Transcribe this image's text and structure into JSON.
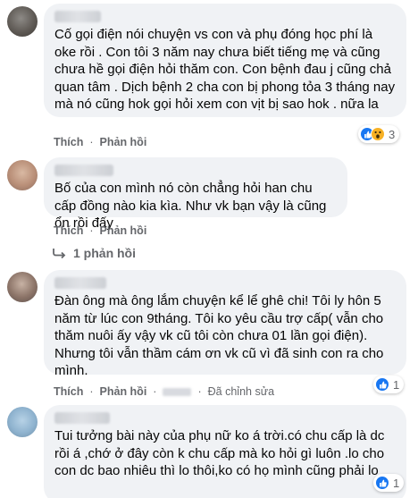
{
  "comments": [
    {
      "text": "Cố gọi điện nói chuyện vs con và phụ đóng học phí là oke rồi . Con tôi 3 năm nay chưa biết tiếng mẹ và cũng chưa hề gọi điện hỏi thăm con. Con bệnh đau j cũng chả quan tâm . Dịch bệnh 2 cha con bị phong tỏa 3 tháng nay mà nó cũng hok gọi hỏi xem con vịt bị sao hok . nữa la",
      "like_label": "Thích",
      "reply_label": "Phản hồi",
      "reaction_count": "3",
      "reaction_icons": [
        "like-icon",
        "wow-icon"
      ]
    },
    {
      "text": "Bố của con mình nó còn chẳng hỏi han chu cấp đồng nào kia kìa. Như vk bạn vậy là cũng ổn rồi đấy",
      "like_label": "Thích",
      "reply_label": "Phản hồi",
      "replies_label": "1 phản hồi"
    },
    {
      "text": "Đàn ông mà ông lắm chuyện kể lể ghê chi! Tôi ly hôn 5 năm từ lúc con 9tháng. Tôi ko yêu cầu trợ cấp( vẫn cho thăm nuôi ấy vậy vk cũ tôi còn chưa 01 lần gọi điện). Nhưng tôi vẫn thầm cám ơn vk cũ vì đã sinh con ra cho mình.",
      "like_label": "Thích",
      "reply_label": "Phản hồi",
      "edited_label": "Đã chỉnh sửa",
      "reaction_count": "1",
      "reaction_icons": [
        "like-icon"
      ]
    },
    {
      "text": "Tui tưởng bài này của phụ nữ ko á trời.có chu cấp là dc rồi á ,chớ ở đây còn k chu cấp mà ko hỏi gì luôn .lo cho con dc bao nhiêu thì lo thôi,ko có họ mình cũng phải lo",
      "reaction_count": "1",
      "reaction_icons": [
        "like-icon"
      ]
    }
  ],
  "colors": {
    "bubble": "#f0f2f5",
    "like_blue": "#1877f2",
    "meta_gray": "#65676b"
  }
}
